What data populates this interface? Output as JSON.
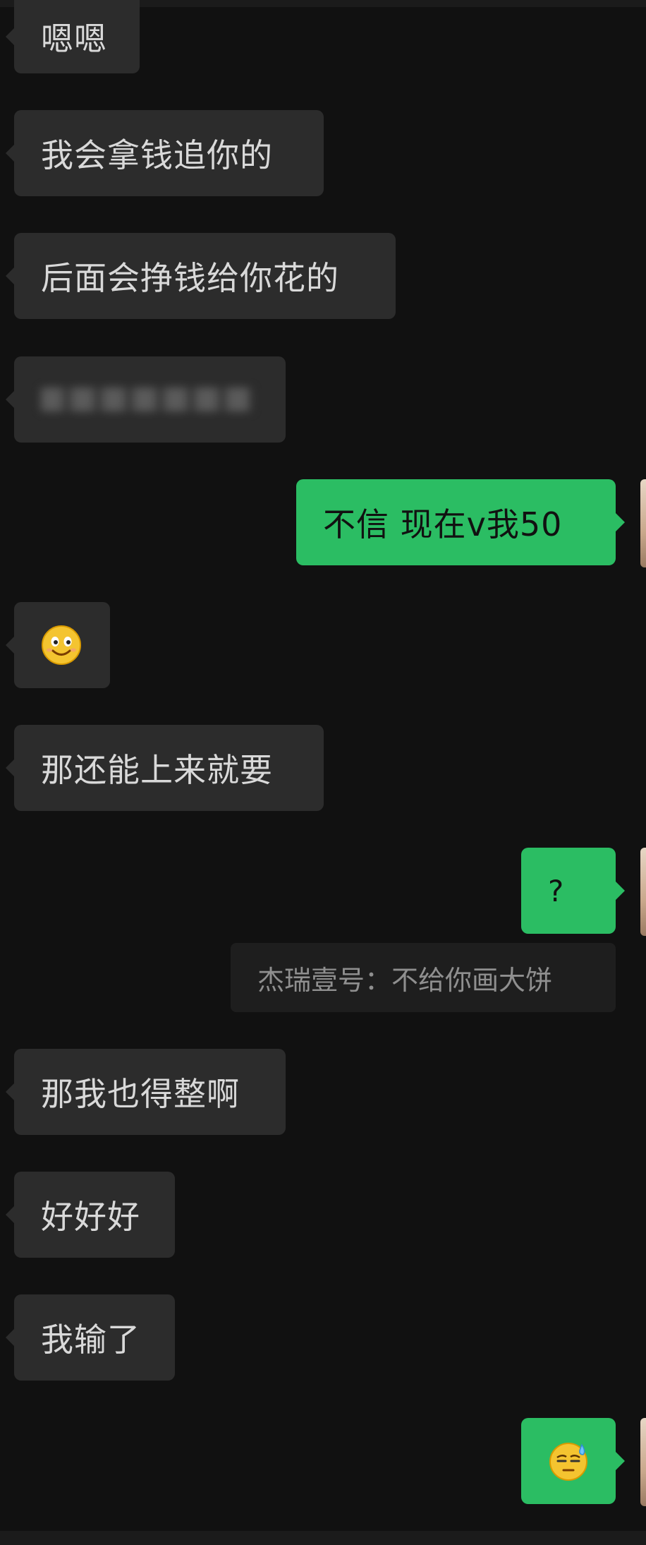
{
  "messages": [
    {
      "side": "in",
      "text": "嗯嗯"
    },
    {
      "side": "in",
      "text": "我会拿钱追你的"
    },
    {
      "side": "in",
      "text": "后面会挣钱给你花的"
    },
    {
      "side": "in",
      "text": "",
      "blurred": true
    },
    {
      "side": "out",
      "text": "不信 现在v我50"
    },
    {
      "side": "in",
      "emoji": "smile-emoji"
    },
    {
      "side": "in",
      "text": "那还能上来就要"
    },
    {
      "side": "out",
      "text": "?"
    },
    {
      "side": "out",
      "quote": "杰瑞壹号：不给你画大饼"
    },
    {
      "side": "in",
      "text": "那我也得整啊"
    },
    {
      "side": "in",
      "text": "好好好"
    },
    {
      "side": "in",
      "text": "我输了"
    },
    {
      "side": "out",
      "emoji": "sweat-emoji"
    }
  ],
  "colors": {
    "background": "#111111",
    "incoming_bubble": "#2c2c2c",
    "outgoing_bubble": "#2bbd63",
    "incoming_text": "#d9d9d9",
    "outgoing_text": "#111111",
    "quote_bg": "#1e1e1e",
    "quote_text": "#8f8f8f"
  }
}
